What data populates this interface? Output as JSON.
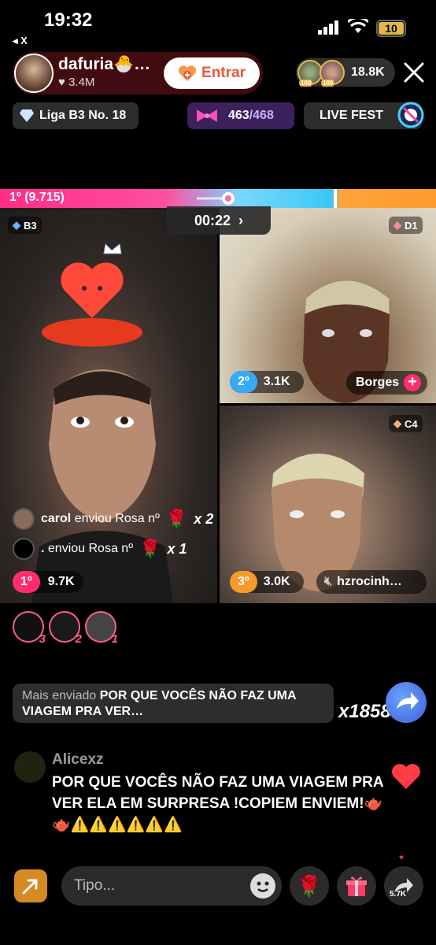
{
  "status": {
    "time": "19:32",
    "back_app": "◂ X",
    "battery": "10"
  },
  "host": {
    "name": "dafuria🐣…",
    "likes": "3.4M",
    "enter_label": "Entrar"
  },
  "viewers": {
    "count": "18.8K",
    "badge": "100"
  },
  "chips": {
    "league": "Liga B3 No. 18",
    "goal_current": "463",
    "goal_separator": "/",
    "goal_total": "468",
    "fest": "LIVE FEST"
  },
  "battle": {
    "top_label": "1º (9.715)",
    "timer": "00:22"
  },
  "players": [
    {
      "tier": "B3",
      "rank": "1º",
      "score": "9.7K"
    },
    {
      "tier": "D1",
      "rank": "2º",
      "score": "3.1K",
      "name": "Borges"
    },
    {
      "tier": "C4",
      "rank": "3º",
      "score": "3.0K",
      "name": "hzrocinh…"
    }
  ],
  "gifts": [
    {
      "user": "carol",
      "text": "enviou Rosa nº",
      "count": "x 2"
    },
    {
      "user": ".",
      "text": "enviou Rosa nº",
      "count": "x 1"
    }
  ],
  "fans": [
    "3",
    "2",
    "1"
  ],
  "banner": {
    "lead": "Mais enviado",
    "message": "POR QUE VOCÊS NÃO FAZ UMA VIAGEM PRA VER…",
    "count": "x1858"
  },
  "comment": {
    "user": "Alicexz",
    "text": "POR QUE VOCÊS NÃO FAZ UMA VIAGEM PRA VER ELA EM SURPRESA !COPIEM ENVIEM!🫖🫖⚠️⚠️⚠️⚠️⚠️⚠️"
  },
  "input": {
    "placeholder": "Tipo..."
  },
  "share": {
    "count": "5.7K"
  },
  "colors": {
    "pink": "#ff2d88",
    "blue": "#38c8f5",
    "orange": "#ff9a2b",
    "accent_enter": "#e8573b"
  }
}
